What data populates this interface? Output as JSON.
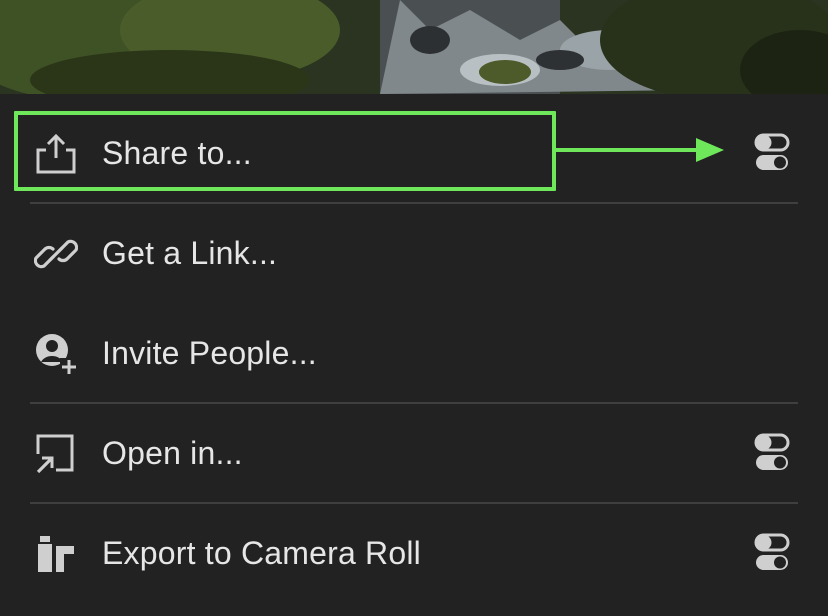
{
  "menu": {
    "items": [
      {
        "label": "Share to...",
        "icon": "share-upload-icon",
        "has_settings": true,
        "highlighted": true
      },
      {
        "label": "Get a Link...",
        "icon": "link-icon",
        "has_settings": false,
        "highlighted": false
      },
      {
        "label": "Invite People...",
        "icon": "invite-person-icon",
        "has_settings": false,
        "highlighted": false
      },
      {
        "label": "Open in...",
        "icon": "open-in-icon",
        "has_settings": true,
        "highlighted": false
      },
      {
        "label": "Export to Camera Roll",
        "icon": "camera-roll-export-icon",
        "has_settings": true,
        "highlighted": false
      }
    ]
  },
  "colors": {
    "background": "#222222",
    "text": "#e6e6e6",
    "icon": "#cfcfcf",
    "divider": "#3f3f3f",
    "highlight": "#6ee85a"
  }
}
